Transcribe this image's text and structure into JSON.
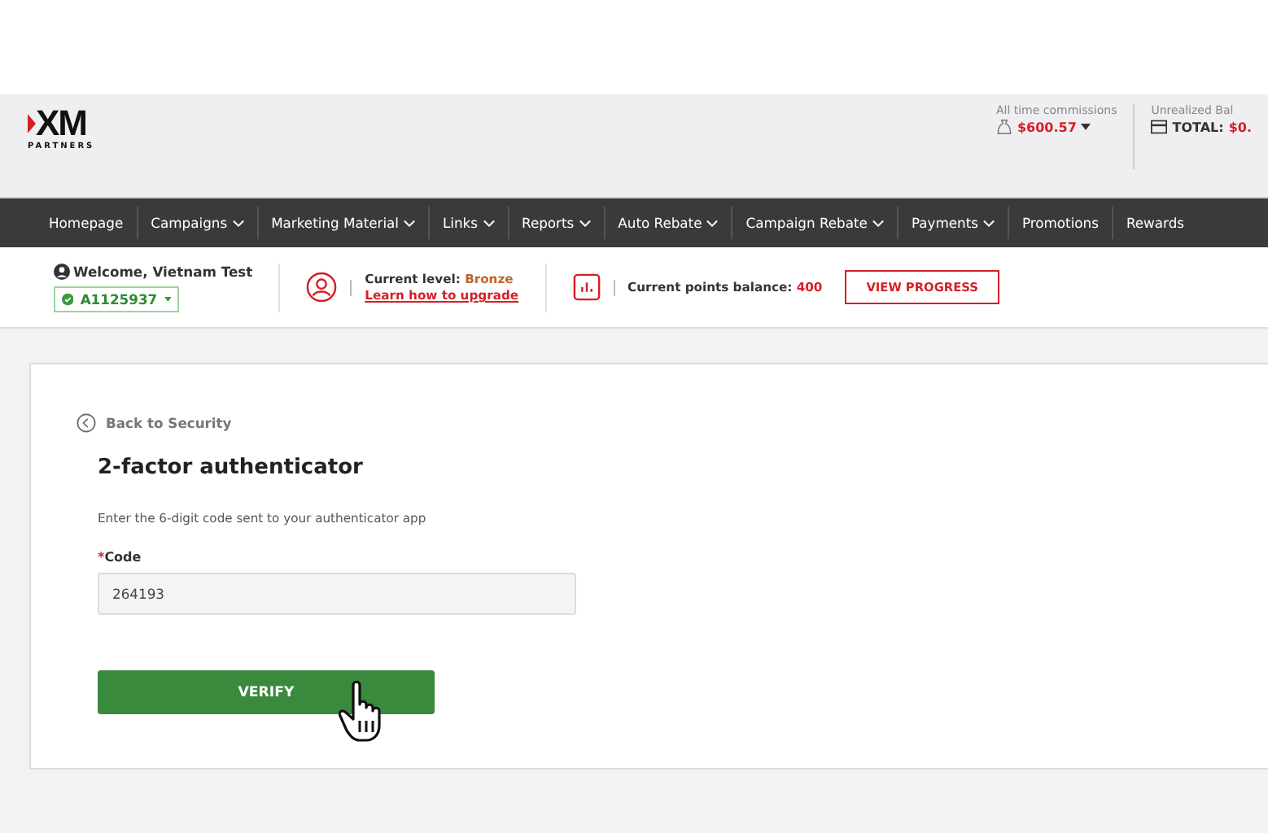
{
  "logo": {
    "mark": "XM",
    "sub": "PARTNERS"
  },
  "header": {
    "commissions": {
      "label": "All time commissions",
      "value": "$600.57"
    },
    "balance": {
      "label": "Unrealized Bal",
      "total_label": "TOTAL:",
      "total_value": "$0."
    }
  },
  "nav": [
    {
      "label": "Homepage",
      "dropdown": false
    },
    {
      "label": "Campaigns",
      "dropdown": true
    },
    {
      "label": "Marketing Material",
      "dropdown": true
    },
    {
      "label": "Links",
      "dropdown": true
    },
    {
      "label": "Reports",
      "dropdown": true
    },
    {
      "label": "Auto Rebate",
      "dropdown": true
    },
    {
      "label": "Campaign Rebate",
      "dropdown": true
    },
    {
      "label": "Payments",
      "dropdown": true
    },
    {
      "label": "Promotions",
      "dropdown": false
    },
    {
      "label": "Rewards",
      "dropdown": false
    }
  ],
  "info": {
    "welcome": "Welcome, Vietnam Test",
    "account": "A1125937",
    "level_label": "Current level:",
    "level_value": "Bronze",
    "upgrade_link": "Learn how to upgrade",
    "points_label": "Current points balance:",
    "points_value": "400",
    "progress_button": "VIEW PROGRESS"
  },
  "form": {
    "back_link": "Back to Security",
    "title": "2-factor authenticator",
    "instruction": "Enter the 6-digit code sent to your authenticator app",
    "required_mark": "*",
    "code_label": "Code",
    "code_value": "264193",
    "submit": "VERIFY"
  }
}
